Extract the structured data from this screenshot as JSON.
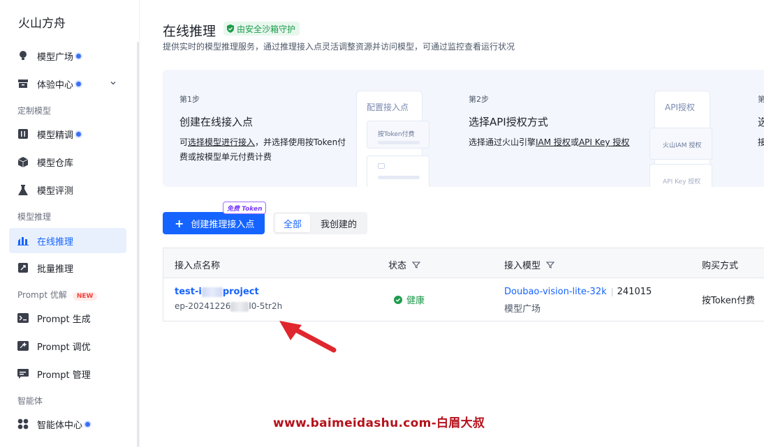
{
  "brand": "火山方舟",
  "sidebar": {
    "items": [
      {
        "label": "模型广场",
        "icon": "lightbulb-icon"
      },
      {
        "label": "体验中心",
        "icon": "box-icon"
      },
      {
        "label": "模型精调",
        "icon": "tune-icon"
      },
      {
        "label": "模型仓库",
        "icon": "cube-icon"
      },
      {
        "label": "模型评测",
        "icon": "flask-icon"
      },
      {
        "label": "在线推理",
        "icon": "chart-icon"
      },
      {
        "label": "批量推理",
        "icon": "rocket-icon"
      },
      {
        "label": "Prompt 生成",
        "icon": "terminal-icon"
      },
      {
        "label": "Prompt 调优",
        "icon": "sparkle-icon"
      },
      {
        "label": "Prompt 管理",
        "icon": "chat-icon"
      },
      {
        "label": "智能体中心",
        "icon": "grid-icon"
      }
    ],
    "sections": [
      "定制模型",
      "模型推理",
      "Prompt 优解",
      "智能体"
    ],
    "new_badge": "NEW"
  },
  "page": {
    "title": "在线推理",
    "sandbox": "由安全沙箱守护",
    "desc": "提供实时的模型推理服务，通过推理接入点灵活调整资源并访问模型，可通过监控查看运行状况"
  },
  "steps": {
    "s1": {
      "label": "第1步",
      "title": "创建在线接入点",
      "desc_pre": "可",
      "desc_link": "选择模型进行接入",
      "desc_post": "，并选择使用按Token付",
      "desc_line2": "费或按模型单元付费计费",
      "mock_head": "配置接入点",
      "mock_item": "按Token付费"
    },
    "s2": {
      "label": "第2步",
      "title": "选择API授权方式",
      "desc_pre": "选择通过火山引擎",
      "desc_link1": "IAM 授权",
      "desc_mid": "或",
      "desc_link2": "API Key 授权",
      "mock_head": "API授权",
      "mock_item1": "火山IAM 授权",
      "mock_item2": "API Key 授权"
    },
    "s3": {
      "label": "第",
      "title": "选",
      "desc": "接"
    }
  },
  "toolbar": {
    "create_label": "创建推理接入点",
    "free_token": "免费 Token",
    "filter_all": "全部",
    "filter_mine": "我创建的"
  },
  "table": {
    "headers": [
      "接入点名称",
      "状态",
      "接入模型",
      "购买方式"
    ],
    "rows": [
      {
        "name_pre": "test-i",
        "name_post": "project",
        "id_pre": "ep-20241226",
        "id_post": "l0-5tr2h",
        "status": "健康",
        "model": "Doubao-vision-lite-32k",
        "version": "241015",
        "source": "模型广场",
        "purchase": "按Token付费"
      }
    ]
  },
  "watermark": "www.baimeidashu.com-白眉大叔",
  "colors": {
    "primary": "#1664ff",
    "success": "#1e9b4b",
    "arrow": "#e0272d"
  }
}
